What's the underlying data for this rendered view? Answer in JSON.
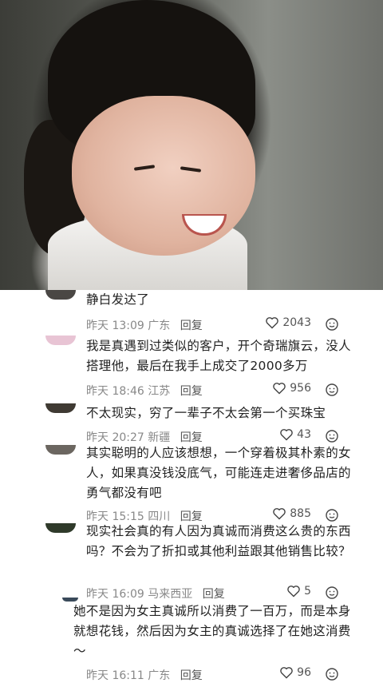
{
  "comments": [
    {
      "text": "静白发达了",
      "time": "昨天 13:09",
      "region": "广东",
      "reply": "回复",
      "likes": "2043"
    },
    {
      "text": "我是真遇到过类似的客户，开个奇瑞旗云，没人搭理他，最后在我手上成交了2000多万",
      "time": "昨天 18:46",
      "region": "江苏",
      "reply": "回复",
      "likes": "956"
    },
    {
      "text": "不太现实，穷了一辈子不太会第一个买珠宝",
      "time": "昨天 20:27",
      "region": "新疆",
      "reply": "回复",
      "likes": "43"
    },
    {
      "text": "其实聪明的人应该想想，一个穿着极其朴素的女人，如果真没钱没底气，可能连走进奢侈品店的勇气都没有吧",
      "time": "昨天 15:15",
      "region": "四川",
      "reply": "回复",
      "likes": "885"
    },
    {
      "text": "现实社会真的有人因为真诚而消费这么贵的东西吗？不会为了折扣或其他利益跟其他销售比较？",
      "time": "昨天 16:09",
      "region": "马来西亚",
      "reply": "回复",
      "likes": "5"
    },
    {
      "text": "她不是因为女主真诚所以消费了一百万，而是本身就想花钱，然后因为女主的真诚选择了在她这消费～",
      "time": "昨天 16:11",
      "region": "广东",
      "reply": "回复",
      "likes": "96"
    }
  ],
  "icons": {
    "like": "heart-outline-icon",
    "emoji": "emoji-icon"
  }
}
